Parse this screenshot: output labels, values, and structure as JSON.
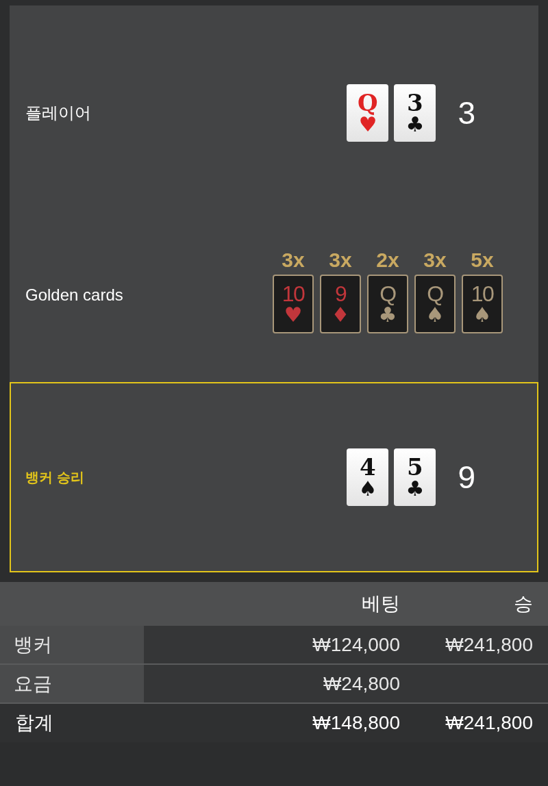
{
  "hands": [
    {
      "kind": "hand",
      "label": "플레이어",
      "highlighted": false,
      "cards": [
        {
          "rank": "Q",
          "suit": "♥",
          "color": "#e02424"
        },
        {
          "rank": "3",
          "suit": "♣",
          "color": "#111111"
        }
      ],
      "total": "3"
    },
    {
      "kind": "golden",
      "label": "Golden cards",
      "highlighted": false,
      "cards": [
        {
          "multiplier": "3x",
          "rank": "10",
          "suit": "♥",
          "color": "#c2363b"
        },
        {
          "multiplier": "3x",
          "rank": "9",
          "suit": "♦",
          "color": "#c2363b"
        },
        {
          "multiplier": "2x",
          "rank": "Q",
          "suit": "♣",
          "color": "#a8977a"
        },
        {
          "multiplier": "3x",
          "rank": "Q",
          "suit": "♠",
          "color": "#a8977a"
        },
        {
          "multiplier": "5x",
          "rank": "10",
          "suit": "♠",
          "color": "#a8977a"
        }
      ]
    },
    {
      "kind": "hand",
      "label": "뱅커 승리",
      "highlighted": true,
      "cards": [
        {
          "rank": "4",
          "suit": "♠",
          "color": "#111111"
        },
        {
          "rank": "5",
          "suit": "♣",
          "color": "#111111"
        }
      ],
      "total": "9"
    }
  ],
  "table": {
    "columns": [
      "베팅",
      "승"
    ],
    "rows": [
      {
        "label": "뱅커",
        "bet": "₩124,000",
        "win": "₩241,800"
      },
      {
        "label": "요금",
        "bet": "₩24,800"
      }
    ],
    "total": {
      "label": "합계",
      "bet": "₩148,800",
      "win": "₩241,800"
    }
  }
}
